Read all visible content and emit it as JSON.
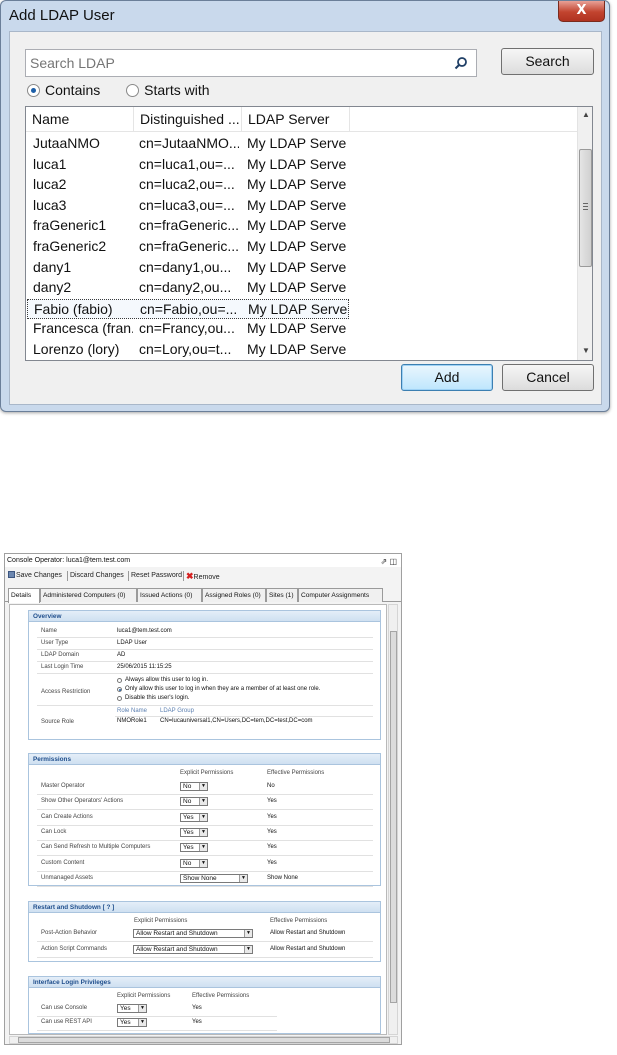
{
  "dialog": {
    "title": "Add LDAP User",
    "close_glyph": "X",
    "search_placeholder": "Search LDAP",
    "search_button": "Search",
    "radio_contains": "Contains",
    "radio_starts_with": "Starts with",
    "columns": [
      "Name",
      "Distinguished ...",
      "LDAP Server"
    ],
    "rows": [
      {
        "name": "JutaaNMO",
        "dn": "cn=JutaaNMO...",
        "server": "My LDAP Server"
      },
      {
        "name": "luca1",
        "dn": "cn=luca1,ou=...",
        "server": "My LDAP Server"
      },
      {
        "name": "luca2",
        "dn": "cn=luca2,ou=...",
        "server": "My LDAP Server"
      },
      {
        "name": "luca3",
        "dn": "cn=luca3,ou=...",
        "server": "My LDAP Server"
      },
      {
        "name": "fraGeneric1",
        "dn": "cn=fraGeneric...",
        "server": "My LDAP Server"
      },
      {
        "name": "fraGeneric2",
        "dn": "cn=fraGeneric...",
        "server": "My LDAP Server"
      },
      {
        "name": "dany1",
        "dn": "cn=dany1,ou...",
        "server": "My LDAP Server"
      },
      {
        "name": "dany2",
        "dn": "cn=dany2,ou...",
        "server": "My LDAP Server"
      },
      {
        "name": "Fabio (fabio)",
        "dn": "cn=Fabio,ou=...",
        "server": "My LDAP Server"
      },
      {
        "name": "Francesca (fran...",
        "dn": "cn=Francy,ou...",
        "server": "My LDAP Server"
      },
      {
        "name": "Lorenzo (lory)",
        "dn": "cn=Lory,ou=t...",
        "server": "My LDAP Server"
      }
    ],
    "selected_row": "Fabio (fabio)",
    "add_button": "Add",
    "cancel_button": "Cancel"
  },
  "console": {
    "title": "Console Operator: luca1@tem.test.com",
    "toolbar": {
      "save": "Save Changes",
      "discard": "Discard Changes",
      "reset": "Reset Password",
      "remove": "Remove"
    },
    "tabs": [
      "Details",
      "Administered Computers (0)",
      "Issued Actions (0)",
      "Assigned Roles (0)",
      "Sites (1)",
      "Computer Assignments"
    ],
    "overview": {
      "header": "Overview",
      "name_label": "Name",
      "name_value": "luca1@tem.test.com",
      "usertype_label": "User Type",
      "usertype_value": "LDAP User",
      "domain_label": "LDAP Domain",
      "domain_value": "AD",
      "login_label": "Last Login Time",
      "login_value": "25/06/2015 11:15:25",
      "access_label": "Access Restriction",
      "access_options": [
        "Always allow this user to log in.",
        "Only allow this user to log in when they are a member of at least one role.",
        "Disable this user's login."
      ],
      "access_selected": "Only allow this user to log in when they are a member of at least one role.",
      "source_label": "Source Role",
      "role_name_header": "Role Name",
      "ldap_group_header": "LDAP Group",
      "role_name_value": "NMORole1",
      "ldap_group_value": "CN=lucauniversal1,CN=Users,DC=tem,DC=test,DC=com"
    },
    "permissions": {
      "header": "Permissions",
      "explicit_header": "Explicit Permissions",
      "effective_header": "Effective Permissions",
      "rows": [
        {
          "label": "Master Operator",
          "explicit": "No",
          "effective": "No"
        },
        {
          "label": "Show Other Operators' Actions",
          "explicit": "No",
          "effective": "Yes"
        },
        {
          "label": "Can Create Actions",
          "explicit": "Yes",
          "effective": "Yes"
        },
        {
          "label": "Can Lock",
          "explicit": "Yes",
          "effective": "Yes"
        },
        {
          "label": "Can Send Refresh to Multiple Computers",
          "explicit": "Yes",
          "effective": "Yes"
        },
        {
          "label": "Custom Content",
          "explicit": "No",
          "effective": "Yes"
        },
        {
          "label": "Unmanaged Assets",
          "explicit": "Show None",
          "effective": "Show None"
        }
      ]
    },
    "restart": {
      "header": "Restart and Shutdown [ ? ]",
      "explicit_header": "Explicit Permissions",
      "effective_header": "Effective Permissions",
      "rows": [
        {
          "label": "Post-Action Behavior",
          "explicit": "Allow Restart and Shutdown",
          "effective": "Allow Restart and Shutdown"
        },
        {
          "label": "Action Script Commands",
          "explicit": "Allow Restart and Shutdown",
          "effective": "Allow Restart and Shutdown"
        }
      ]
    },
    "interface": {
      "header": "Interface Login Privileges",
      "explicit_header": "Explicit Permissions",
      "effective_header": "Effective Permissions",
      "rows": [
        {
          "label": "Can use Console",
          "explicit": "Yes",
          "effective": "Yes"
        },
        {
          "label": "Can use REST API",
          "explicit": "Yes",
          "effective": "Yes"
        }
      ]
    }
  },
  "icons": {
    "search": "magnifier",
    "close": "x",
    "remove": "red-x"
  }
}
